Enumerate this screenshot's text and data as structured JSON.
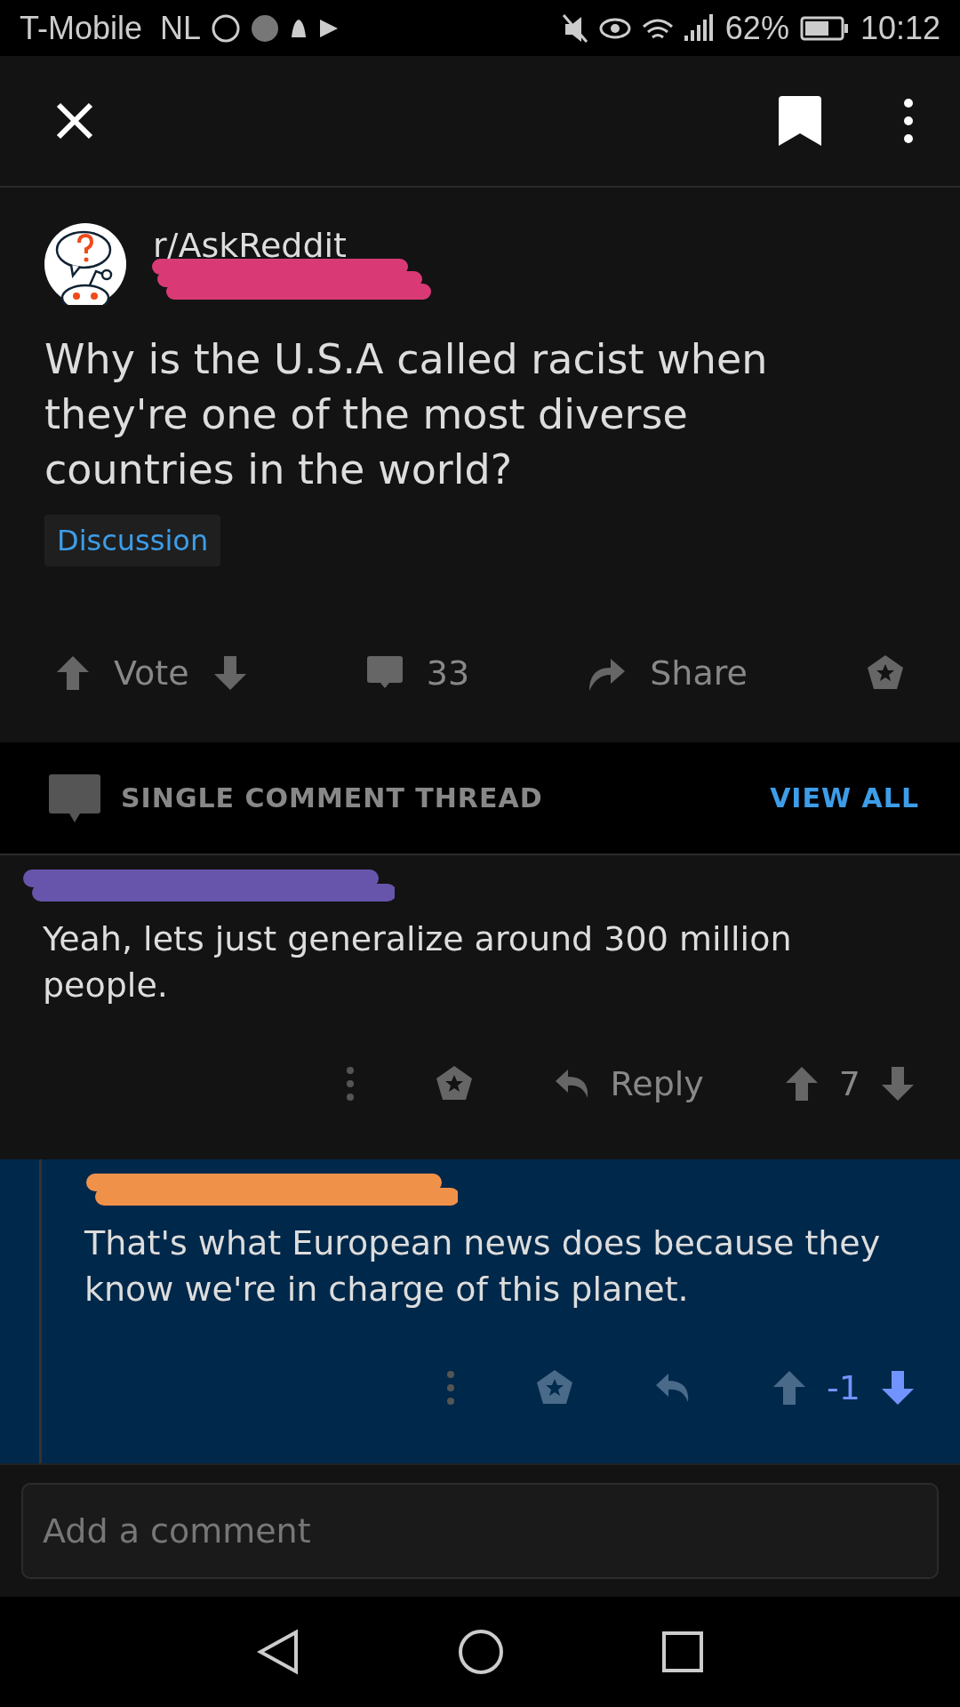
{
  "status_bar": {
    "carrier": "T-Mobile  NL",
    "battery": "62%",
    "time": "10:12"
  },
  "post": {
    "subreddit": "r/AskReddit",
    "title": "Why is the U.S.A called racist when they're one of the most diverse countries in the world?",
    "flair": "Discussion",
    "vote_label": "Vote",
    "comments": "33",
    "share": "Share"
  },
  "thread": {
    "label": "SINGLE COMMENT THREAD",
    "view_all": "VIEW ALL"
  },
  "comments": [
    {
      "color": "#6655aa",
      "body": "Yeah, lets just generalize around 300 million people.",
      "reply": "Reply",
      "score": "7",
      "upvoted": false,
      "downvoted": false,
      "highlighted": false,
      "nested": false
    },
    {
      "color": "#f0914a",
      "body": "That's what European news does because they know we're in charge of this planet.",
      "score": "-1",
      "upvoted": false,
      "downvoted": true,
      "highlighted": true,
      "nested": true
    }
  ],
  "composer": {
    "placeholder": "Add a comment"
  }
}
